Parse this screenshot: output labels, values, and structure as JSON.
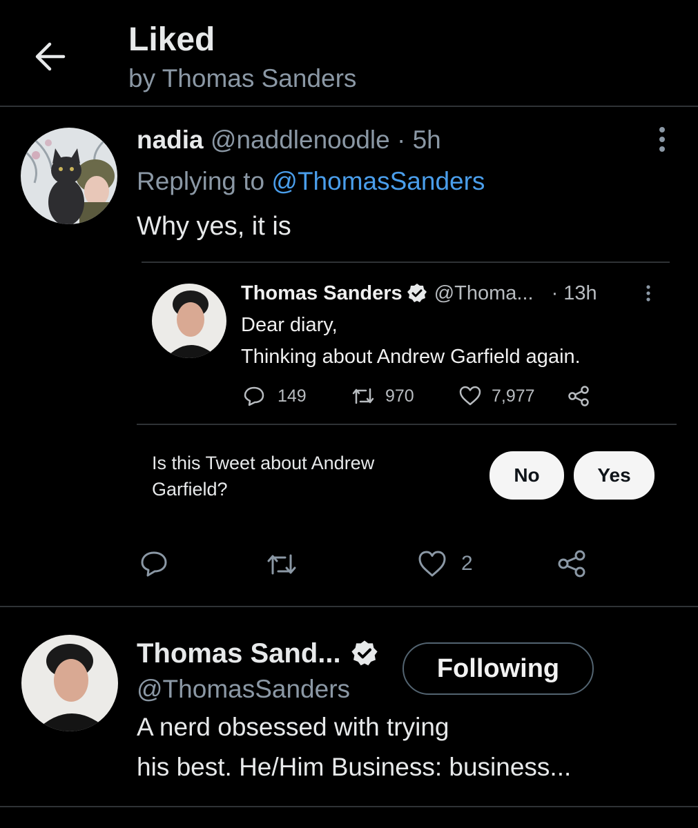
{
  "header": {
    "title": "Liked",
    "subtitle": "by Thomas Sanders"
  },
  "tweet": {
    "display_name": "nadia",
    "handle": "@naddlenoodle",
    "separator": "·",
    "time": "5h",
    "replying_prefix": "Replying to",
    "replying_to": "@ThomasSanders",
    "text": "Why yes, it is",
    "quoted": {
      "display_name": "Thomas Sanders",
      "handle": "@Thoma...",
      "time": "· 13h",
      "line1": "Dear diary,",
      "line2": "Thinking about Andrew Garfield again.",
      "stats": {
        "replies": "149",
        "retweets": "970",
        "likes": "7,977"
      },
      "prompt_line1": "Is this Tweet about Andrew",
      "prompt_line2": "Garfield?",
      "no_label": "No",
      "yes_label": "Yes"
    },
    "actions": {
      "likes": "2"
    }
  },
  "user_card": {
    "display_name": "Thomas Sand...",
    "handle": "@ThomasSanders",
    "follow_label": "Following",
    "bio_line1": "A nerd obsessed with trying",
    "bio_line2": "his best. He/Him Business: business..."
  },
  "colors": {
    "background": "#000000",
    "text": "#e7e9ea",
    "secondary": "#8b98a5",
    "link": "#4a9eeb",
    "divider": "#2f3336"
  }
}
